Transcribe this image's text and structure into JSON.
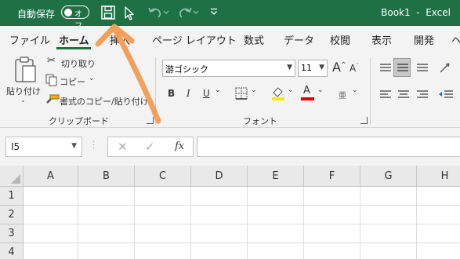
{
  "titlebar": {
    "autosave_label": "自動保存",
    "autosave_toggle": "オフ",
    "title": "Book1  -  Excel",
    "qat_icons": [
      "save-icon",
      "cursor-icon",
      "undo-icon",
      "redo-icon",
      "customize-qat-icon"
    ]
  },
  "tabs": [
    "ファイル",
    "ホーム",
    "挿入",
    "ページ レイアウト",
    "数式",
    "データ",
    "校閲",
    "表示",
    "開発",
    "ヘ"
  ],
  "active_tab": "ホーム",
  "clipboard": {
    "paste": "貼り付け",
    "cut": "切り取り",
    "copy": "コピー",
    "format_painter": "書式のコピー/貼り付け",
    "group_label": "クリップボード"
  },
  "font": {
    "name": "游ゴシック",
    "size": "11",
    "group_label": "フォント",
    "bold": "B",
    "italic": "I",
    "underline": "U",
    "grow": "A",
    "shrink": "A",
    "phonetic": "亜"
  },
  "formula_bar": {
    "cell_ref": "I5",
    "fx": "fx",
    "content": ""
  },
  "grid": {
    "columns": [
      "A",
      "B",
      "C",
      "D",
      "E",
      "F",
      "G",
      "H"
    ],
    "rows": [
      "1",
      "2",
      "3",
      "4"
    ]
  },
  "colors": {
    "excel_green": "#1e7145",
    "annotation_arrow": "#f5a05a",
    "highlight_yellow": "#ffeb00",
    "font_red": "#e00000"
  }
}
